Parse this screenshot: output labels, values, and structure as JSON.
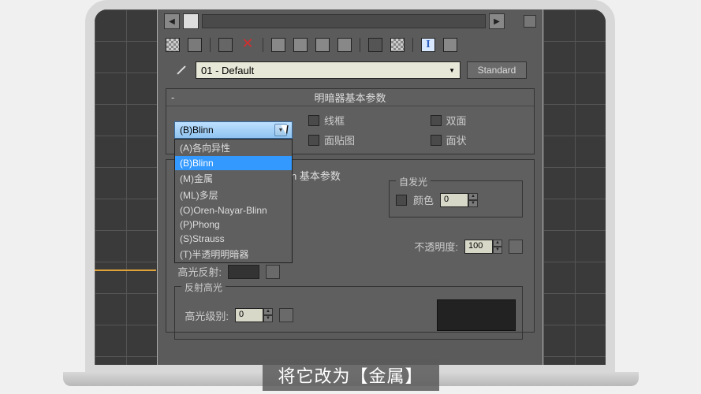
{
  "material": {
    "name": "01 - Default",
    "type_button": "Standard"
  },
  "rollouts": {
    "shader_basic": "明暗器基本参数",
    "blinn_basic_suffix": "n  基本参数"
  },
  "shader": {
    "selected": "(B)Blinn",
    "options": [
      "(A)各向异性",
      "(B)Blinn",
      "(M)金属",
      "(ML)多层",
      "(O)Oren-Nayar-Blinn",
      "(P)Phong",
      "(S)Strauss",
      "(T)半透明明暗器"
    ],
    "highlighted_index": 1
  },
  "checks": {
    "wire": "线框",
    "two_sided": "双面",
    "face_map": "面贴图",
    "faceted": "面状"
  },
  "self_illum": {
    "group": "自发光",
    "color_label": "颜色",
    "value": "0"
  },
  "opacity": {
    "label": "不透明度:",
    "value": "100"
  },
  "spec_refl_label": "高光反射:",
  "reflect_highlight": {
    "group": "反射高光",
    "level_label": "高光级别:",
    "level_value": "0"
  },
  "caption": "将它改为【金属】"
}
